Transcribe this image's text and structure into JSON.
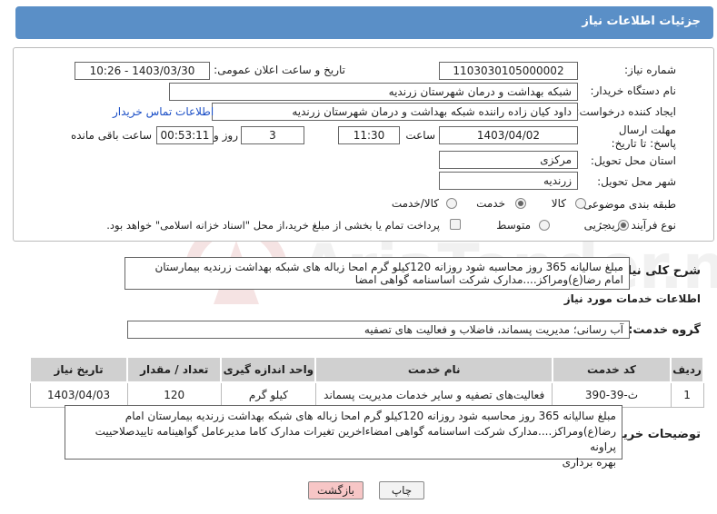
{
  "header": {
    "title": "جزئیات اطلاعات نیاز"
  },
  "fields": {
    "need_number_label": "شماره نیاز:",
    "need_number": "1103030105000002",
    "announce_label": "تاریخ و ساعت اعلان عمومی:",
    "announce_value": "1403/03/30 - 10:26",
    "buyer_org_label": "نام دستگاه خریدار:",
    "buyer_org": "شبکه بهداشت و درمان شهرستان زرندیه",
    "creator_label": "ایجاد کننده درخواست:",
    "creator": "داود کیان زاده راننده شبکه بهداشت و درمان شهرستان زرندیه",
    "contact_link": "اطلاعات تماس خریدار",
    "deadline_label": "مهلت ارسال پاسخ: تا تاریخ:",
    "deadline_date": "1403/04/02",
    "time_label": "ساعت",
    "deadline_time": "11:30",
    "days_value": "3",
    "days_label": "روز و",
    "remaining_time": "00:53:11",
    "remaining_label": "ساعت باقی مانده",
    "province_label": "استان محل تحویل:",
    "province": "مرکزی",
    "city_label": "شهر محل تحویل:",
    "city": "زرندیه",
    "category_label": "طبقه بندی موضوعی:",
    "category_options": [
      "کالا",
      "خدمت",
      "کالا/خدمت"
    ],
    "process_label": "نوع فرآیند خرید :",
    "process_options": [
      "جزیی",
      "متوسط"
    ],
    "payment_note": "پرداخت تمام یا بخشی از مبلغ خرید،از محل \"اسناد خزانه اسلامی\" خواهد بود."
  },
  "summary": {
    "label": "شرح کلی نیاز:",
    "line1": "مبلغ سالیانه 365 روز محاسبه شود  روزانه 120کیلو گرم امحا زباله های شبکه بهداشت زرندیه بیمارستان",
    "line2": "امام رضا(ع)ومراکز....مدارک شرکت اساسنامه  گواهی امضا"
  },
  "services": {
    "section_title": "اطلاعات خدمات مورد نیاز",
    "group_label": "گروه خدمت:",
    "group_value": "آب رسانی؛ مدیریت پسماند، فاضلاب و فعالیت های تصفیه",
    "columns": [
      "ردیف",
      "کد خدمت",
      "نام خدمت",
      "واحد اندازه گیری",
      "تعداد / مقدار",
      "تاریخ نیاز"
    ],
    "rows": [
      {
        "row": "1",
        "code": "ث-39-390",
        "name": "فعالیت‌های تصفیه و سایر خدمات مدیریت پسماند",
        "unit": "کیلو گرم",
        "qty": "120",
        "date": "1403/04/03"
      }
    ]
  },
  "buyer_notes": {
    "label": "توضیحات خریدار:",
    "line1": "مبلغ سالیانه 365 روز محاسبه شود  روزانه 120کیلو گرم امحا زباله های شبکه بهداشت زرندیه بیمارستان امام",
    "line2": "رضا(ع)ومراکز....مدارک شرکت اساسنامه  گواهی امضاءاخرین تغیرات مدارک کاما مدیرعامل گواهینامه  تاییدصلاحییت پراونه",
    "line3": "بهره برداری"
  },
  "buttons": {
    "print": "چاپ",
    "back": "بازگشت"
  },
  "watermark": {
    "text": "AriaTender.neT"
  },
  "colors": {
    "header": "#5a8fc7",
    "link": "#1a4ec6",
    "back_button": "#f7c6c6"
  }
}
